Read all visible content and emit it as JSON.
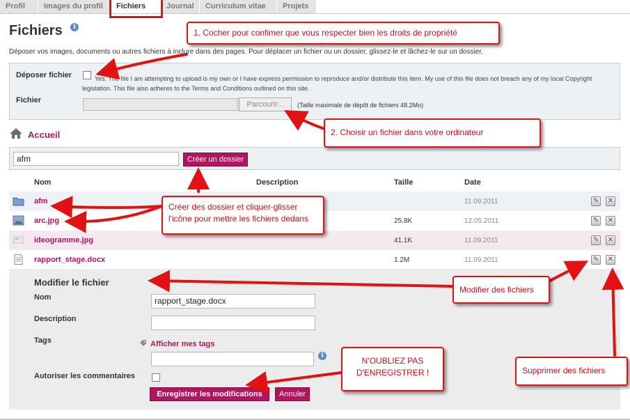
{
  "tabs": [
    {
      "label": "Profil",
      "active": false
    },
    {
      "label": "Images du profil",
      "active": false
    },
    {
      "label": "Fichiers",
      "active": true
    },
    {
      "label": "Journal",
      "active": false
    },
    {
      "label": "Curriculum vitae",
      "active": false
    },
    {
      "label": "Projets",
      "active": false
    }
  ],
  "page": {
    "title": "Fichiers",
    "info_icon": "i",
    "intro": "Déposer vos images, documents ou autres fichiers à inclure dans des pages. Pour déplacer un fichier ou un dossier, glissez-le et lâchez-le sur un dossier."
  },
  "upload": {
    "deposit_label": "Déposer fichier",
    "terms": "Yes: The file I am attempting to upload is my own or I have express permission to reproduce and/or distribute this item. My use of this file does not breach any of my local Copyright legislation. This file also adheres to the Terms and Conditions outlined on this site.",
    "file_label": "Fichier",
    "browse_label": "Parcourir...",
    "max_size": "(Taille maximale de dépôt de fichiers 48.2Mo)"
  },
  "breadcrumb": {
    "home": "Accueil"
  },
  "folder": {
    "input_value": "afm",
    "create_label": "Créer un dossier"
  },
  "table": {
    "headers": {
      "name": "Nom",
      "description": "Description",
      "size": "Taille",
      "date": "Date"
    },
    "rows": [
      {
        "name": "afm",
        "icon": "folder-icon",
        "size": "",
        "date": "11.09.2011"
      },
      {
        "name": "arc.jpg",
        "icon": "image-icon",
        "size": "25.8K",
        "date": "12.05.2011"
      },
      {
        "name": "ideogramme.jpg",
        "icon": "image-icon",
        "size": "41.1K",
        "date": "11.09.2011"
      },
      {
        "name": "rapport_stage.docx",
        "icon": "document-icon",
        "size": "1.2M",
        "date": "11.09.2011"
      }
    ]
  },
  "edit": {
    "title": "Modifier le fichier",
    "name_label": "Nom",
    "name_value": "rapport_stage.docx",
    "description_label": "Description",
    "description_value": "",
    "tags_label": "Tags",
    "show_tags": "Afficher mes tags",
    "tags_value": "",
    "comments_label": "Autoriser les commentaires",
    "save_label": "Enregistrer les modifications",
    "cancel_label": "Annuler"
  },
  "annotations": {
    "a1": "1. Cocher pour confimer que vous respecter bien les droits de propriété",
    "a2": "2. Choisir un fichier dans votre ordinateur",
    "a3": "Créer des dossier et cliquer-glisser l'icône pour mettre les fichiers dedans",
    "a4": "Modifier des fichiers",
    "a5": "N'OUBLIEZ PAS D'ENREGISTRER !",
    "a6": "Supprimer des fichiers"
  },
  "colors": {
    "accent": "#b0155e",
    "annotation": "#e21212"
  }
}
